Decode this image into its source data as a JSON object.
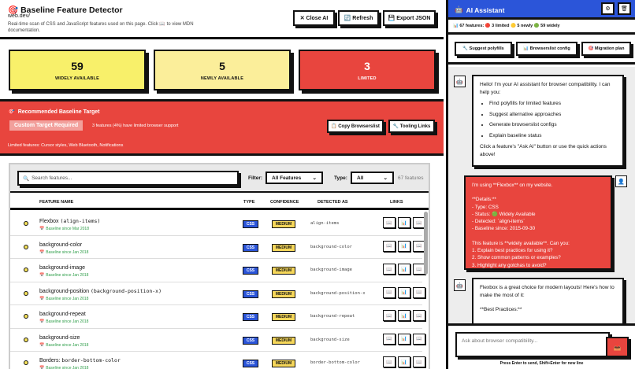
{
  "header": {
    "title_icon": "🎯",
    "title": "Baseline Feature Detector",
    "url": "web.dev/",
    "description": "Real-time scan of CSS and JavaScript features used on this page. Click 📖 to view MDN documentation.",
    "close_ai": "✕ Close AI",
    "refresh": "🔄 Refresh",
    "export": "💾 Export JSON"
  },
  "stats": [
    {
      "value": "59",
      "label": "WIDELY AVAILABLE",
      "color": "#f8f06a"
    },
    {
      "value": "5",
      "label": "NEWLY AVAILABLE",
      "color": "#fbee9a"
    },
    {
      "value": "3",
      "label": "LIMITED",
      "color": "#e8453e"
    }
  ],
  "recommended": {
    "icon": "🎯",
    "title": "Recommended Baseline Target",
    "badge": "Custom Target Required",
    "info": "3 features (4%) have limited browser support",
    "copy_btn": "📋 Copy Browserslist",
    "tooling_btn": "🔧 Tooling Links",
    "limited": "Limited features: Cursor styles, Web Bluetooth, Notifications"
  },
  "filters": {
    "search_icon": "🔍",
    "search_placeholder": "Search features...",
    "filter_label": "Filter:",
    "filter_value": "All Features",
    "type_label": "Type:",
    "type_value": "All",
    "count": "67 features"
  },
  "table": {
    "columns": [
      "FEATURE NAME",
      "TYPE",
      "CONFIDENCE",
      "DETECTED AS",
      "LINKS"
    ],
    "rows": [
      {
        "name": "Flexbox",
        "code": "(align-items)",
        "since": "Baseline since Mar 2018",
        "type": "CSS",
        "confidence": "MEDIUM",
        "detected": "align-items"
      },
      {
        "name": "background-color",
        "code": "",
        "since": "Baseline since Jan 2018",
        "type": "CSS",
        "confidence": "MEDIUM",
        "detected": "background-color"
      },
      {
        "name": "background-image",
        "code": "",
        "since": "Baseline since Jan 2018",
        "type": "CSS",
        "confidence": "MEDIUM",
        "detected": "background-image"
      },
      {
        "name": "background-position",
        "code": "(background-position-x)",
        "since": "Baseline since Jan 2018",
        "type": "CSS",
        "confidence": "MEDIUM",
        "detected": "background-position-x"
      },
      {
        "name": "background-repeat",
        "code": "",
        "since": "Baseline since Jan 2018",
        "type": "CSS",
        "confidence": "MEDIUM",
        "detected": "background-repeat"
      },
      {
        "name": "background-size",
        "code": "",
        "since": "Baseline since Jan 2018",
        "type": "CSS",
        "confidence": "MEDIUM",
        "detected": "background-size"
      },
      {
        "name": "Borders:",
        "code": "border-bottom-color",
        "since": "Baseline since Jan 2018",
        "type": "CSS",
        "confidence": "MEDIUM",
        "detected": "border-bottom-color"
      }
    ],
    "calendar_icon": "📅",
    "link_icons": [
      "📖",
      "📊",
      "📖"
    ]
  },
  "assistant": {
    "title_icon": "🤖",
    "title": "AI Assistant",
    "settings_icon": "⚙",
    "clear_icon": "🗑",
    "summary": "📊 67 features: 🔴 3 limited 🟡 5 newly 🟢 59 widely",
    "actions": [
      "🔧 Suggest polyfills",
      "📊 Browserslist config",
      "🎯 Migration plan"
    ],
    "bot_icon": "🤖",
    "user_icon": "👤",
    "msg1_intro": "Hello! I'm your AI assistant for browser compatibility. I can help you:",
    "msg1_items": [
      "Find polyfills for limited features",
      "Suggest alternative approaches",
      "Generate browserslist configs",
      "Explain baseline status"
    ],
    "msg1_outro": "Click a feature's \"Ask AI\" button or use the quick actions above!",
    "msg2": [
      "I'm using **Flexbox** on my website.",
      "",
      "**Details:**",
      "- Type: CSS",
      "- Status: 🟢 Widely Available",
      "- Detected: `align-items`",
      "- Baseline since: 2015-09-30",
      "",
      "This feature is **widely available**. Can you:",
      "1. Explain best practices for using it?",
      "2. Show common patterns or examples?",
      "3. Highlight any gotchas to avoid?"
    ],
    "msg3": [
      "Flexbox is a great choice for modern layouts! Here's how to make the most of it:",
      "",
      "**Best Practices:**"
    ],
    "input_placeholder": "Ask about browser compatibility...",
    "send_icon": "📤",
    "hint": "Press Enter to send, Shift+Enter for new line"
  }
}
